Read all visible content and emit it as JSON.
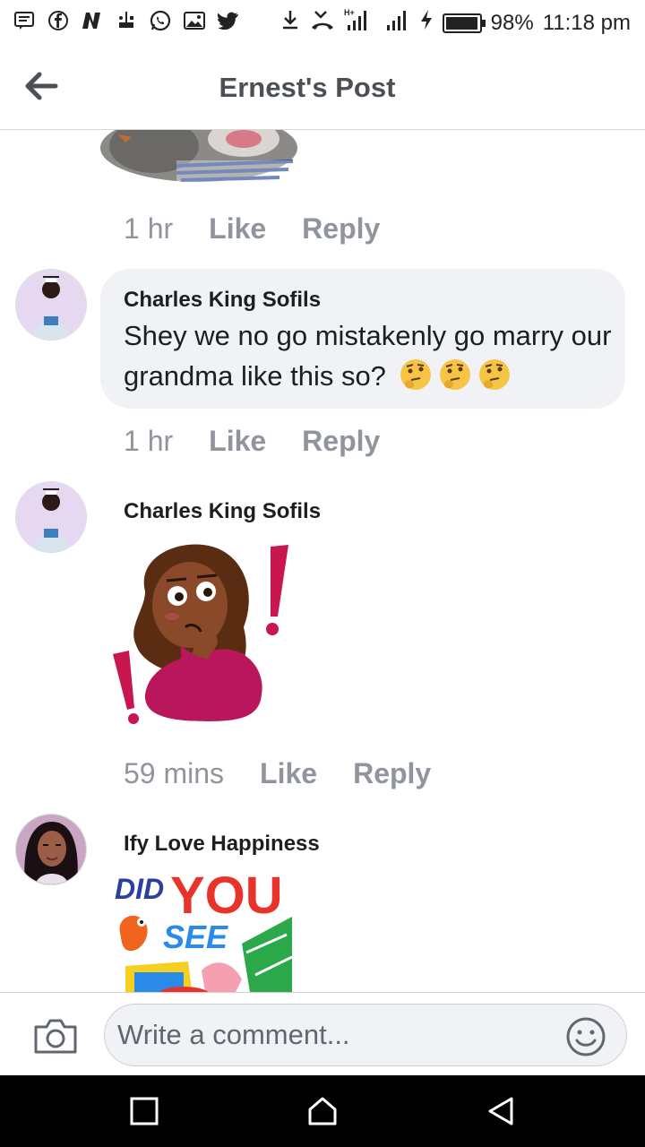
{
  "status_bar": {
    "battery_text": "98%",
    "battery_level": 0.98,
    "time": "11:18 pm",
    "notification_icons": [
      "message-icon",
      "facebook-icon",
      "news-icon",
      "usb-icon",
      "whatsapp-icon",
      "gallery-icon",
      "twitter-icon"
    ],
    "right_icons": [
      "download-icon",
      "missed-call-icon",
      "signal-h-plus-icon",
      "signal-icon",
      "charging-icon",
      "battery-icon"
    ]
  },
  "header": {
    "title": "Ernest's Post",
    "back_icon": "arrow-left-icon"
  },
  "comments": [
    {
      "time": "1 hr",
      "like_label": "Like",
      "reply_label": "Reply"
    },
    {
      "author": "Charles King Sofils",
      "text": "Shey we no go mistakenly go marry our grandma like this so?",
      "emojis": [
        "thinking-face-icon",
        "thinking-face-icon",
        "thinking-face-icon"
      ],
      "time": "1 hr",
      "like_label": "Like",
      "reply_label": "Reply"
    },
    {
      "author": "Charles King Sofils",
      "sticker": "thinking-woman-sticker",
      "time": "59 mins",
      "like_label": "Like",
      "reply_label": "Reply"
    },
    {
      "author": "Ify Love Happiness",
      "sticker": "did-you-see-sticker",
      "sticker_text_1": "DID",
      "sticker_text_2": "YOU",
      "sticker_text_3": "SEE"
    }
  ],
  "composer": {
    "placeholder": "Write a comment...",
    "camera_icon": "camera-icon",
    "emoji_icon": "smiley-icon"
  },
  "nav_bar": {
    "buttons": [
      "recents-square-icon",
      "home-icon",
      "back-triangle-icon"
    ]
  },
  "colors": {
    "meta_gray": "#90949c",
    "bubble_bg": "#f0f2f5",
    "title_gray": "#4b4f56"
  }
}
